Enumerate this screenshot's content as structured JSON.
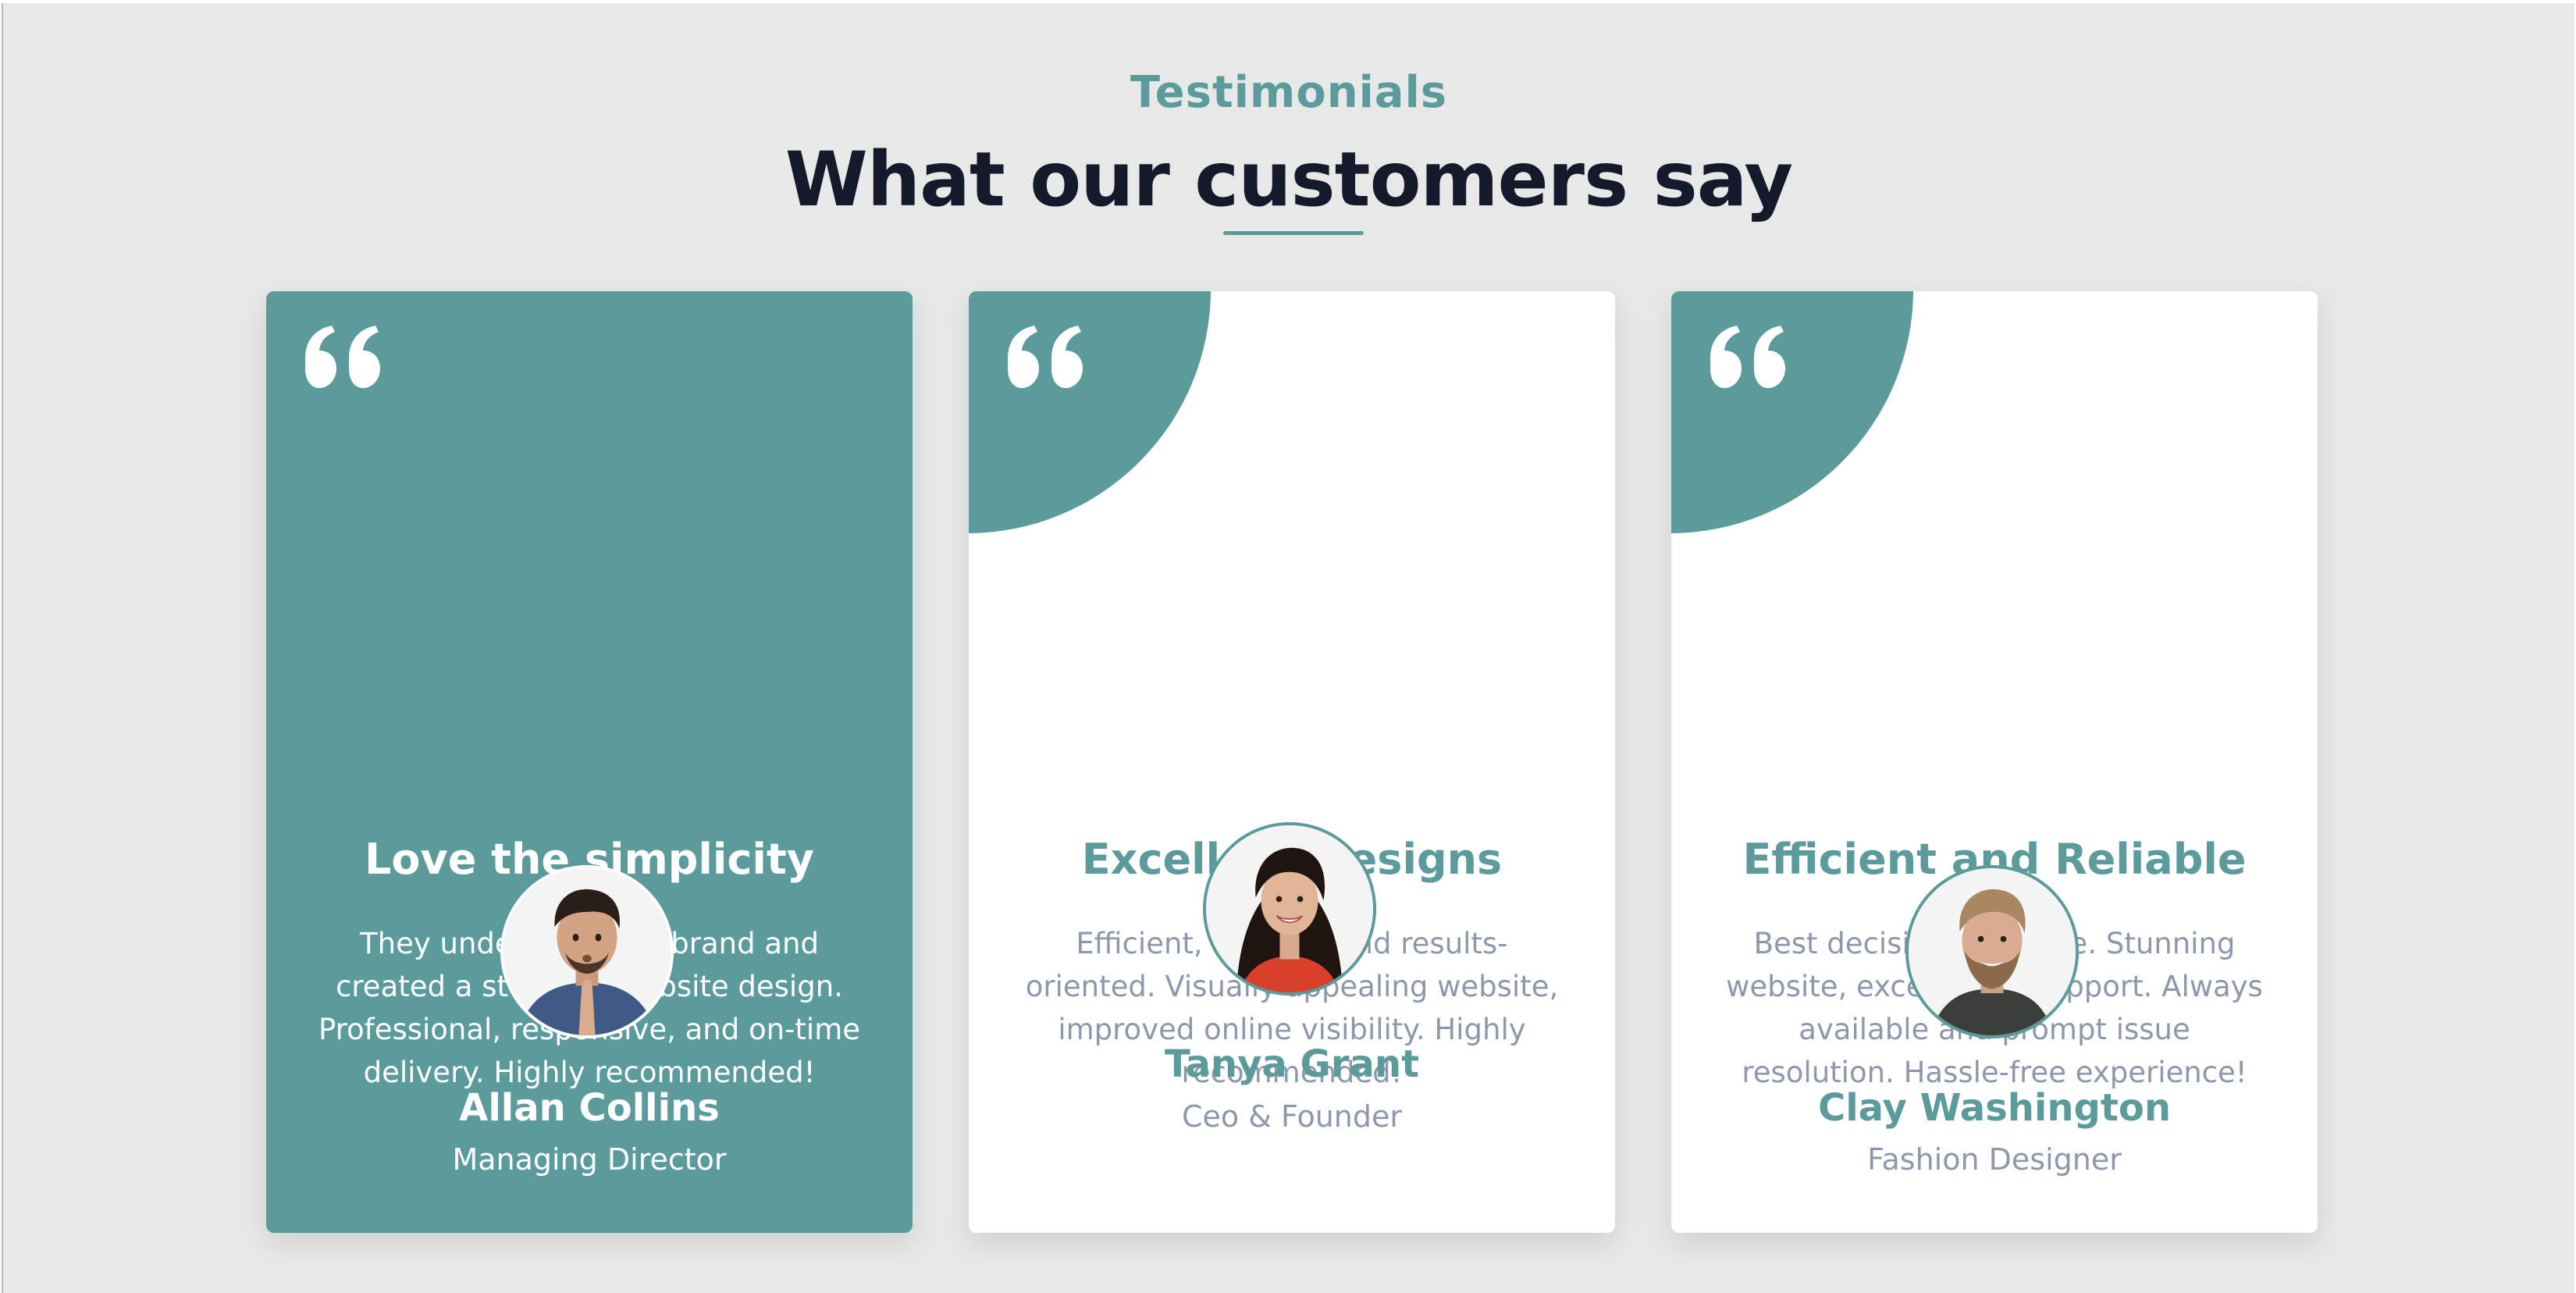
{
  "theme": {
    "accent": "#5c9b9b",
    "background": "#e8e8e8",
    "card_background": "#ffffff",
    "heading_color": "#141a2b",
    "muted_text": "#8d98ac"
  },
  "section": {
    "eyebrow": "Testimonials",
    "headline": "What our customers say"
  },
  "testimonials": [
    {
      "icon": "quote-icon",
      "title": "Love the simplicity",
      "text": "They understood our brand and created a stunning website design. Professional, responsive, and on-time delivery. Highly recommended!",
      "avatar": "avatar-man-praying-hands",
      "name": "Allan Collins",
      "role": "Managing Director",
      "featured": true
    },
    {
      "icon": "quote-icon",
      "title": "Excellent Designs",
      "text": "Efficient, reliable, and results-oriented. Visually appealing website, improved online visibility. Highly recommended!",
      "avatar": "avatar-woman-smiling",
      "name": "Tanya Grant",
      "role": "Ceo & Founder",
      "featured": false
    },
    {
      "icon": "quote-icon",
      "title": "Efficient and Reliable",
      "text": "Best decision we made. Stunning website, exceptional support. Always available and prompt issue resolution. Hassle-free experience!",
      "avatar": "avatar-bearded-man-smiling",
      "name": "Clay Washington",
      "role": "Fashion Designer",
      "featured": false
    }
  ]
}
